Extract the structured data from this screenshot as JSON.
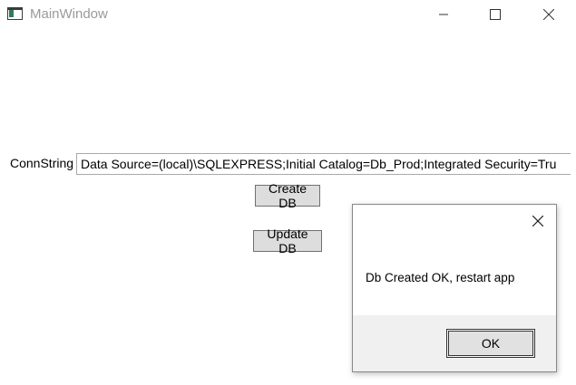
{
  "window": {
    "title": "MainWindow",
    "icon": "app-window-icon"
  },
  "form": {
    "conn_label": "ConnString",
    "conn_value": "Data Source=(local)\\SQLEXPRESS;Initial Catalog=Db_Prod;Integrated Security=Tru",
    "create_label": "Create DB",
    "update_label": "Update DB"
  },
  "dialog": {
    "message": "Db Created OK, restart app",
    "ok_label": "OK"
  },
  "colors": {
    "button_bg": "#dddddd",
    "dialog_footer_bg": "#f0f0f0",
    "title_text": "#9a9a9a"
  }
}
